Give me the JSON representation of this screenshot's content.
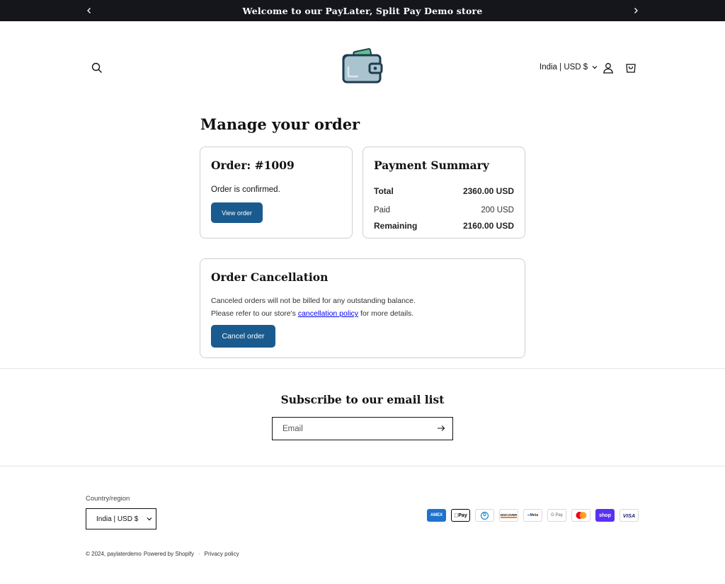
{
  "announcement": {
    "text": "Welcome to our PayLater, Split Pay Demo store"
  },
  "header": {
    "locale_label": "India | USD $",
    "icons": {
      "search": "search-icon",
      "account": "account-icon",
      "cart": "cart-icon",
      "logo": "wallet-logo"
    }
  },
  "main": {
    "title": "Manage your order",
    "order_card": {
      "title": "Order: #1009",
      "status": "Order is confirmed.",
      "button": "View order"
    },
    "payment_summary": {
      "title": "Payment Summary",
      "rows": [
        {
          "label": "Total",
          "value": "2360.00 USD"
        },
        {
          "label": "Paid",
          "value": "200 USD"
        },
        {
          "label": "Remaining",
          "value": "2160.00 USD"
        }
      ]
    },
    "cancellation": {
      "title": "Order Cancellation",
      "line1": "Canceled orders will not be billed for any outstanding balance.",
      "line2_prefix": "Please refer to our store's ",
      "line2_link": "cancellation policy",
      "line2_suffix": " for more details.",
      "button": "Cancel order"
    }
  },
  "subscribe": {
    "title": "Subscribe to our email list",
    "placeholder": "Email"
  },
  "footer": {
    "country_label": "Country/region",
    "country_value": "India | USD $",
    "payment_methods": [
      "AMEX",
      "Pay",
      "D",
      "DISCOVER",
      "Meta",
      "G Pay",
      "",
      "shop",
      "VISA"
    ],
    "copyright": "© 2024, paylaterdemo",
    "powered": "Powered by Shopify",
    "separator": "·",
    "privacy": "Privacy policy"
  },
  "colors": {
    "accent": "#1a5b8f",
    "announce_bg": "#14161c",
    "shop_pay": "#5a31f4"
  }
}
